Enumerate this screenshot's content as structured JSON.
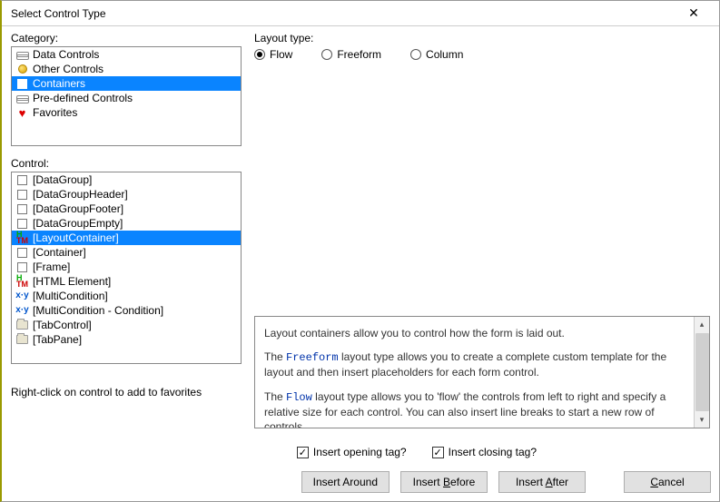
{
  "window": {
    "title": "Select Control Type"
  },
  "labels": {
    "category": "Category:",
    "control": "Control:",
    "layout_type": "Layout type:",
    "hint": "Right-click on control to add to favorites",
    "insert_opening": "Insert opening tag?",
    "insert_closing": "Insert closing tag?"
  },
  "categories": [
    {
      "icon": "db",
      "label": "Data Controls",
      "selected": false
    },
    {
      "icon": "dot",
      "label": "Other Controls",
      "selected": false
    },
    {
      "icon": "ck",
      "label": "Containers",
      "selected": true
    },
    {
      "icon": "db",
      "label": "Pre-defined Controls",
      "selected": false
    },
    {
      "icon": "heart",
      "label": "Favorites",
      "selected": false
    }
  ],
  "controls": [
    {
      "icon": "ck",
      "label": "[DataGroup]",
      "selected": false
    },
    {
      "icon": "ck",
      "label": "[DataGroupHeader]",
      "selected": false
    },
    {
      "icon": "ck",
      "label": "[DataGroupFooter]",
      "selected": false
    },
    {
      "icon": "ck",
      "label": "[DataGroupEmpty]",
      "selected": false
    },
    {
      "icon": "htm",
      "label": "[LayoutContainer]",
      "selected": true
    },
    {
      "icon": "ck",
      "label": "[Container]",
      "selected": false
    },
    {
      "icon": "ck",
      "label": "[Frame]",
      "selected": false
    },
    {
      "icon": "htm",
      "label": "[HTML Element]",
      "selected": false
    },
    {
      "icon": "xy",
      "label": "[MultiCondition]",
      "selected": false
    },
    {
      "icon": "xy",
      "label": "[MultiCondition - Condition]",
      "selected": false
    },
    {
      "icon": "folder",
      "label": "[TabControl]",
      "selected": false
    },
    {
      "icon": "folder",
      "label": "[TabPane]",
      "selected": false
    }
  ],
  "layout_types": [
    {
      "label": "Flow",
      "selected": true
    },
    {
      "label": "Freeform",
      "selected": false
    },
    {
      "label": "Column",
      "selected": false
    }
  ],
  "description": {
    "p1": "Layout containers allow you to control how the form is laid out.",
    "p2a": "The ",
    "p2kw": "Freeform",
    "p2b": " layout type allows you to create a complete custom template for the layout and then insert placeholders for each form control.",
    "p3a": "The ",
    "p3kw": "Flow",
    "p3b": " layout type allows you to 'flow' the controls from left to right and specify a relative size for each control. You can also insert line breaks to start a new row of controls."
  },
  "checks": {
    "opening": true,
    "closing": true
  },
  "buttons": {
    "insert_around": "Insert Around",
    "insert_before": "Insert Before",
    "insert_after": "Insert After",
    "cancel": "Cancel"
  }
}
